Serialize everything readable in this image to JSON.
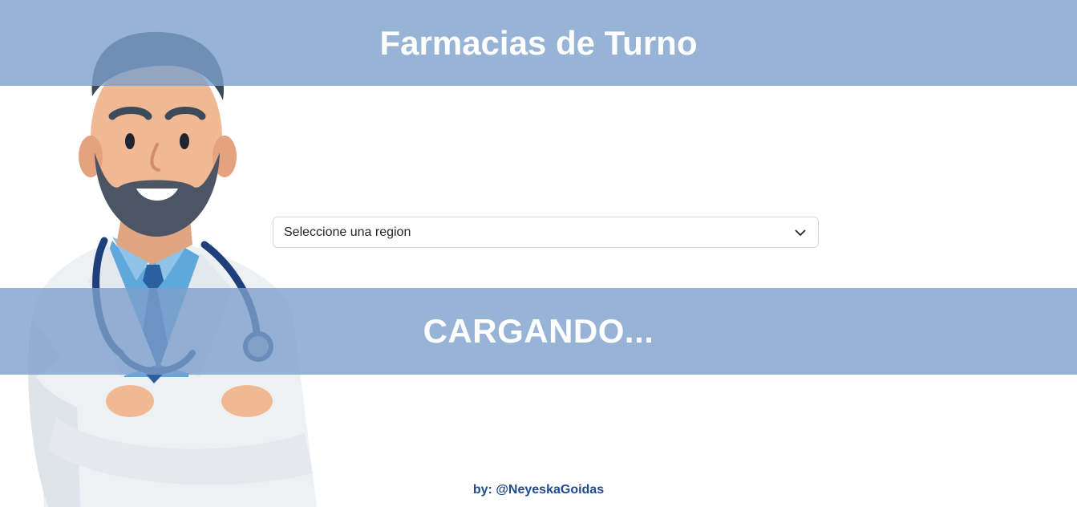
{
  "header": {
    "title": "Farmacias de Turno"
  },
  "region_select": {
    "selected": "Seleccione una region",
    "icon": "chevron-down-icon"
  },
  "status": {
    "loading_text": "CARGANDO..."
  },
  "footer": {
    "credit": "by: @NeyeskaGoidas"
  },
  "colors": {
    "band": "#94b2d6",
    "credit_text": "#1f4a8c",
    "doctor_coat": "#eef1f4",
    "doctor_shirt": "#5ea8dc",
    "doctor_tie": "#2a5fa0",
    "stethoscope": "#1f3f7a"
  }
}
